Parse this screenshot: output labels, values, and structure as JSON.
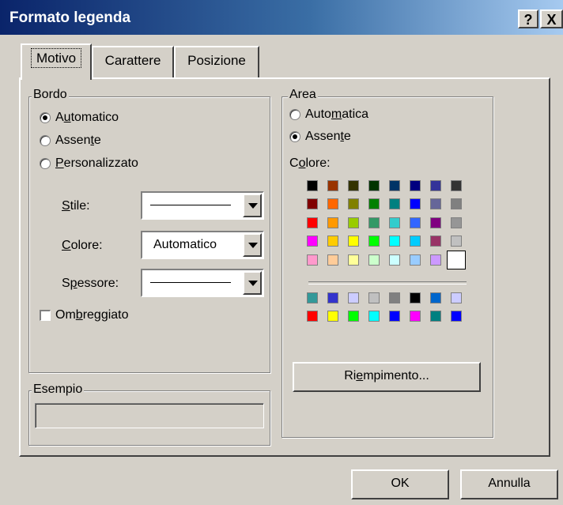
{
  "window": {
    "title": "Formato legenda",
    "help_label": "?",
    "close_label": "X"
  },
  "tabs": [
    {
      "label": "Motivo"
    },
    {
      "label": "Carattere"
    },
    {
      "label": "Posizione"
    }
  ],
  "bordo": {
    "group_label": "Bordo",
    "options": [
      {
        "pre": "A",
        "u": "u",
        "post": "tomatico",
        "selected": true
      },
      {
        "pre": "Assen",
        "u": "t",
        "post": "e",
        "selected": false
      },
      {
        "pre": "",
        "u": "P",
        "post": "ersonalizzato",
        "selected": false
      }
    ],
    "stile": {
      "pre": "",
      "u": "S",
      "post": "tile:"
    },
    "colore": {
      "pre": "",
      "u": "C",
      "post": "olore:",
      "value": "Automatico"
    },
    "spessore": {
      "pre": "S",
      "u": "p",
      "post": "essore:"
    },
    "ombreggiato": {
      "pre": "Om",
      "u": "b",
      "post": "reggiato"
    }
  },
  "esempio": {
    "group_label": "Esempio"
  },
  "area": {
    "group_label": "Area",
    "options": [
      {
        "pre": "Auto",
        "u": "m",
        "post": "atica",
        "selected": false
      },
      {
        "pre": "Assen",
        "u": "t",
        "post": "e",
        "selected": true
      }
    ],
    "colore_label": {
      "pre": "C",
      "u": "o",
      "post": "lore:"
    },
    "palette": [
      [
        "#000000",
        "#993300",
        "#333300",
        "#003300",
        "#003366",
        "#000080",
        "#333399",
        "#333333"
      ],
      [
        "#800000",
        "#ff6600",
        "#808000",
        "#008000",
        "#008080",
        "#0000ff",
        "#666699",
        "#808080"
      ],
      [
        "#ff0000",
        "#ff9900",
        "#99cc00",
        "#339966",
        "#33cccc",
        "#3366ff",
        "#800080",
        "#969696"
      ],
      [
        "#ff00ff",
        "#ffcc00",
        "#ffff00",
        "#00ff00",
        "#00ffff",
        "#00ccff",
        "#993366",
        "#c0c0c0"
      ],
      [
        "#ff99cc",
        "#ffcc99",
        "#ffff99",
        "#ccffcc",
        "#ccffff",
        "#99ccff",
        "#cc99ff",
        "#ffffff"
      ]
    ],
    "palette_extra": [
      [
        "#339999",
        "#3333cc",
        "#ccccff",
        "#c0c0c0",
        "#808080",
        "#000000",
        "#0066cc",
        "#ccccff"
      ],
      [
        "#ff0000",
        "#ffff00",
        "#00ff00",
        "#00ffff",
        "#0000ff",
        "#ff00ff",
        "#008080",
        "#0000ff"
      ]
    ],
    "riempimento": {
      "pre": "Ri",
      "u": "e",
      "post": "mpimento..."
    }
  },
  "buttons": {
    "ok": "OK",
    "cancel": "Annulla"
  }
}
